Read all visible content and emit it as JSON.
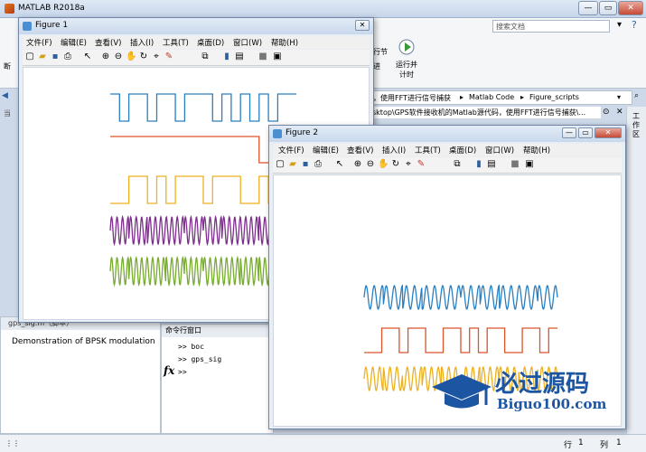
{
  "app": {
    "title": "MATLAB R2018a",
    "icon": "matlab-icon"
  },
  "search": {
    "placeholder": "搜索文档"
  },
  "ribbon": {
    "left_char": "断",
    "section_label": "行节",
    "advance_label": "进",
    "run_time_label1": "运行并",
    "run_time_label2": "计时"
  },
  "path": {
    "segments": [
      "，使用FFT进行信号捕获",
      "Matlab Code",
      "Figure_scripts"
    ]
  },
  "breadcrumb": "sktop\\GPS软件接收机的Matlab源代码，使用FFT进行信号捕获\\...",
  "side": {
    "workspace_label": "工作区",
    "current_label": "当"
  },
  "gps_panel": {
    "title": "gps_sig.m（脚本）",
    "description": "Demonstration of BPSK modulation"
  },
  "command_window": {
    "title": "命令行窗口",
    "lines": [
      ">> boc",
      ">> gps_sig"
    ],
    "prompt": ">>",
    "fx": "fx"
  },
  "status": {
    "row_label": "行",
    "row_value": "1",
    "col_label": "列",
    "col_value": "1"
  },
  "figure1": {
    "title": "Figure 1"
  },
  "figure2": {
    "title": "Figure 2"
  },
  "menus": [
    "文件(F)",
    "编辑(E)",
    "查看(V)",
    "插入(I)",
    "工具(T)",
    "桌面(D)",
    "窗口(W)",
    "帮助(H)"
  ],
  "toolbar_icons": [
    "new-file-icon",
    "open-folder-icon",
    "save-icon",
    "print-icon",
    "pointer-icon",
    "zoom-in-icon",
    "zoom-out-icon",
    "pan-icon",
    "rotate-icon",
    "data-cursor-icon",
    "brush-icon",
    "link-icon",
    "colorbar-icon",
    "legend-icon",
    "hide-plot-icon",
    "show-plot-icon"
  ],
  "watermark": {
    "line1": "必过源码",
    "line2": "Biguo100.com"
  },
  "colors": {
    "blue": "#2a7fc1",
    "orange": "#d9532b",
    "yellow": "#edb120",
    "purple": "#7e2f8e",
    "green": "#77ac30"
  }
}
